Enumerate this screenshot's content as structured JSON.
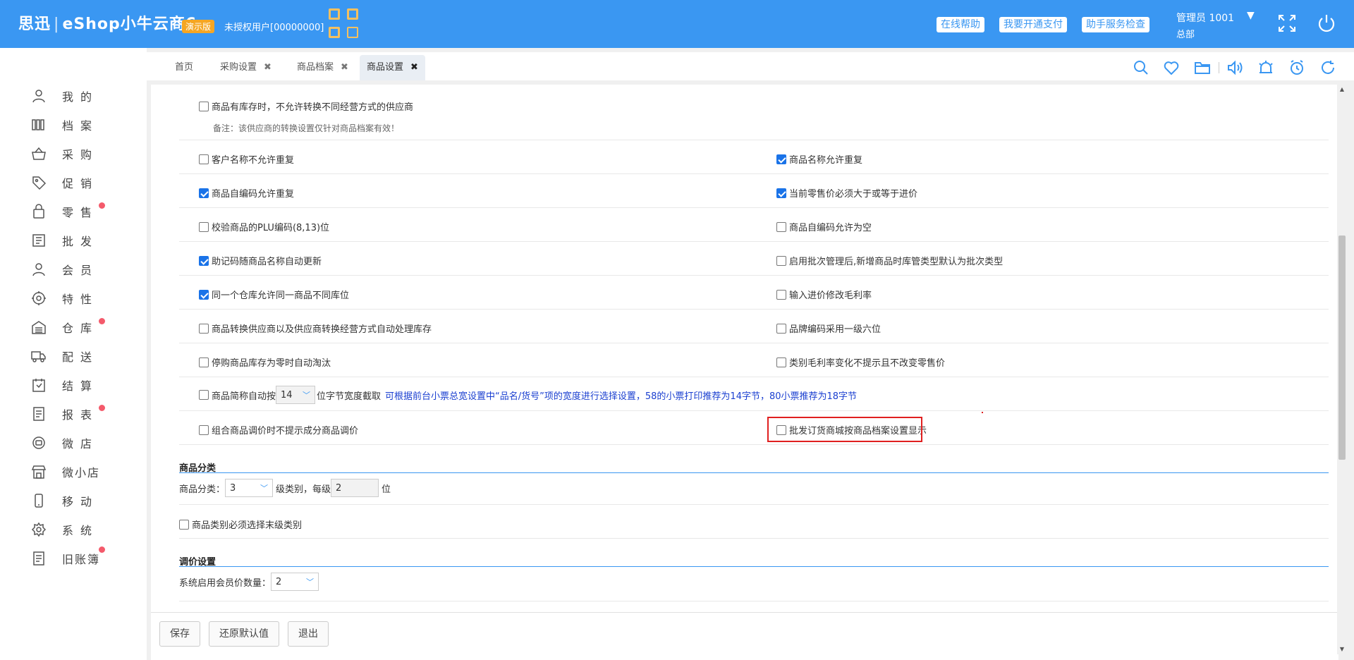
{
  "header": {
    "brand": "思迅",
    "product": "eShop小牛云商6",
    "demo_badge": "演示版",
    "license": "未授权用户[00000000]",
    "buttons": [
      "在线帮助",
      "我要开通支付",
      "助手服务检查"
    ],
    "user": "管理员 1001",
    "org": "总部",
    "icons": [
      "qrcode-icon",
      "fullscreen-icon",
      "power-icon"
    ]
  },
  "sidebar": {
    "items": [
      {
        "label": "我的",
        "icon": "user-icon",
        "dot": false
      },
      {
        "label": "档案",
        "icon": "archive-icon",
        "dot": false
      },
      {
        "label": "采购",
        "icon": "basket-icon",
        "dot": false
      },
      {
        "label": "促销",
        "icon": "tag-icon",
        "dot": false
      },
      {
        "label": "零售",
        "icon": "bag-icon",
        "dot": true
      },
      {
        "label": "批发",
        "icon": "wholesale-icon",
        "dot": false
      },
      {
        "label": "会员",
        "icon": "member-icon",
        "dot": false
      },
      {
        "label": "特性",
        "icon": "feature-icon",
        "dot": false
      },
      {
        "label": "仓库",
        "icon": "warehouse-icon",
        "dot": true
      },
      {
        "label": "配送",
        "icon": "truck-icon",
        "dot": false
      },
      {
        "label": "结算",
        "icon": "settle-icon",
        "dot": false
      },
      {
        "label": "报表",
        "icon": "report-icon",
        "dot": true
      },
      {
        "label": "微店",
        "icon": "microstore-icon",
        "dot": false
      },
      {
        "label": "微小店",
        "icon": "shop-icon",
        "dot": false
      },
      {
        "label": "移动",
        "icon": "mobile-icon",
        "dot": false
      },
      {
        "label": "系统",
        "icon": "gear-icon",
        "dot": false
      },
      {
        "label": "旧账簿",
        "icon": "ledger-icon",
        "dot": true
      }
    ]
  },
  "tabs": [
    {
      "label": "首页",
      "closable": false,
      "active": false
    },
    {
      "label": "采购设置",
      "closable": true,
      "active": false
    },
    {
      "label": "商品档案",
      "closable": true,
      "active": false
    },
    {
      "label": "商品设置",
      "closable": true,
      "active": true
    }
  ],
  "tab_close": "✖",
  "toolbar_icons": [
    "search-icon",
    "heart-icon",
    "folder-icon",
    "speaker-icon",
    "alarm-icon",
    "clock-icon",
    "refresh-icon"
  ],
  "settings": {
    "top_option": {
      "label": "商品有库存时，不允许转换不同经营方式的供应商",
      "checked": false
    },
    "top_note": "备注：该供应商的转换设置仅针对商品档案有效！",
    "left": [
      {
        "label": "客户名称不允许重复",
        "checked": false
      },
      {
        "label": "商品自编码允许重复",
        "checked": true
      },
      {
        "label": "校验商品的PLU编码(8,13)位",
        "checked": false
      },
      {
        "label": "助记码随商品名称自动更新",
        "checked": true
      },
      {
        "label": "同一个仓库允许同一商品不同库位",
        "checked": true
      },
      {
        "label": "商品转换供应商以及供应商转换经营方式自动处理库存",
        "checked": false
      },
      {
        "label": "停购商品库存为零时自动淘汰",
        "checked": false
      },
      {
        "label": "商品简称自动按",
        "checked": false
      },
      {
        "label": "组合商品调价时不提示成分商品调价",
        "checked": false
      }
    ],
    "right": [
      {
        "label": "商品名称允许重复",
        "checked": true
      },
      {
        "label": "当前零售价必须大于或等于进价",
        "checked": true
      },
      {
        "label": "商品自编码允许为空",
        "checked": false
      },
      {
        "label": "启用批次管理后,新增商品时库管类型默认为批次类型",
        "checked": false
      },
      {
        "label": "输入进价修改毛利率",
        "checked": false
      },
      {
        "label": "品牌编码采用一级六位",
        "checked": false
      },
      {
        "label": "类别毛利率变化不提示且不改变零售价",
        "checked": false
      },
      {
        "label": "",
        "checked": false
      },
      {
        "label": "批发订货商城按商品档案设置显示",
        "checked": false
      }
    ],
    "abbrev_width": "14",
    "abbrev_suffix": "位字节宽度截取",
    "abbrev_hint": "可根据前台小票总宽设置中“品名/货号”项的宽度进行选择设置，58的小票打印推荐为14字节，80小票推荐为18字节"
  },
  "category_section": {
    "title": "商品分类",
    "label": "商品分类：",
    "levels": "3",
    "mid_text": "级类别，每级",
    "digits": "2",
    "unit": "位",
    "last_level": {
      "label": "商品类别必须选择末级类别",
      "checked": false
    }
  },
  "price_section": {
    "title": "调价设置",
    "member_price_label": "系统启用会员价数量：",
    "member_price_count": "2"
  },
  "footer": {
    "buttons": [
      "保存",
      "还原默认值",
      "退出"
    ]
  }
}
